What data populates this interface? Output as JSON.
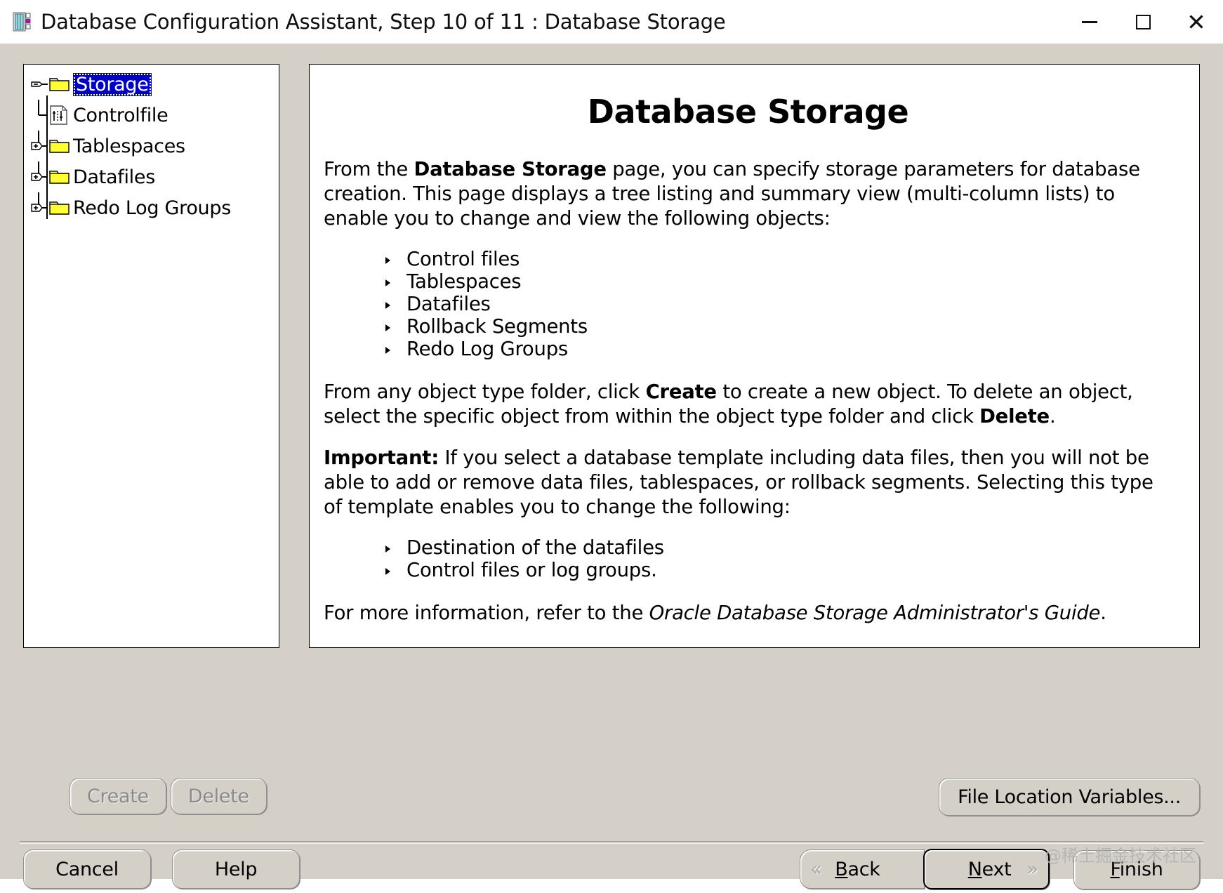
{
  "window": {
    "title": "Database Configuration Assistant, Step 10 of 11 : Database Storage",
    "icon": "database-app-icon",
    "controls": {
      "minimize": "minimize-icon",
      "maximize": "maximize-icon",
      "close": "close-icon"
    }
  },
  "tree": {
    "root": {
      "label": "Storage",
      "selected": true,
      "expander": "minus",
      "icon": "folder-icon"
    },
    "items": [
      {
        "label": "Controlfile",
        "expander": "none",
        "icon": "controlfile-document-icon"
      },
      {
        "label": "Tablespaces",
        "expander": "plus",
        "icon": "folder-icon"
      },
      {
        "label": "Datafiles",
        "expander": "plus",
        "icon": "folder-icon"
      },
      {
        "label": "Redo Log Groups",
        "expander": "plus",
        "icon": "folder-icon"
      }
    ]
  },
  "info": {
    "title": "Database Storage",
    "para1_pre": "From the ",
    "para1_bold": "Database Storage",
    "para1_post": " page, you can specify storage parameters for database creation. This page displays a tree listing and summary view (multi-column lists) to enable you to change and view the following objects:",
    "list1": [
      "Control files",
      "Tablespaces",
      "Datafiles",
      "Rollback Segments",
      "Redo Log Groups"
    ],
    "para2_pre": "From any object type folder, click ",
    "para2_bold1": "Create",
    "para2_mid": " to create a new object. To delete an object, select the specific object from within the object type folder and click ",
    "para2_bold2": "Delete",
    "para2_post": ".",
    "para3_bold": "Important:",
    "para3_text": " If you select a database template including data files, then you will not be able to add or remove data files, tablespaces, or rollback segments. Selecting this type of template enables you to change the following:",
    "list2": [
      "Destination of the datafiles",
      "Control files or log groups."
    ],
    "para4_pre": "For more information, refer to the ",
    "para4_italic": "Oracle Database Storage Administrator's Guide",
    "para4_post": "."
  },
  "actions": {
    "create": {
      "label": "Create",
      "enabled": false
    },
    "delete": {
      "label": "Delete",
      "enabled": false
    },
    "file_location_variables": {
      "label": "File Location Variables..."
    }
  },
  "nav": {
    "cancel": "Cancel",
    "help": "Help",
    "back": {
      "label": "Back",
      "mnemonic": "B",
      "rest": "ack",
      "icon": "chevron-left-icon"
    },
    "next": {
      "label": "Next",
      "mnemonic": "N",
      "rest": "ext",
      "icon": "chevron-right-icon",
      "focused": true
    },
    "finish": {
      "label": "Finish",
      "mnemonic": "F",
      "rest": "inish"
    }
  },
  "watermark": "@稀土掘金技术社区",
  "colors": {
    "dialog_face": "#d4d0c8",
    "selection_blue": "#0000c0",
    "folder_yellow": "#ffff00",
    "titlebar_bg": "#ffffff",
    "panel_white": "#ffffff"
  }
}
